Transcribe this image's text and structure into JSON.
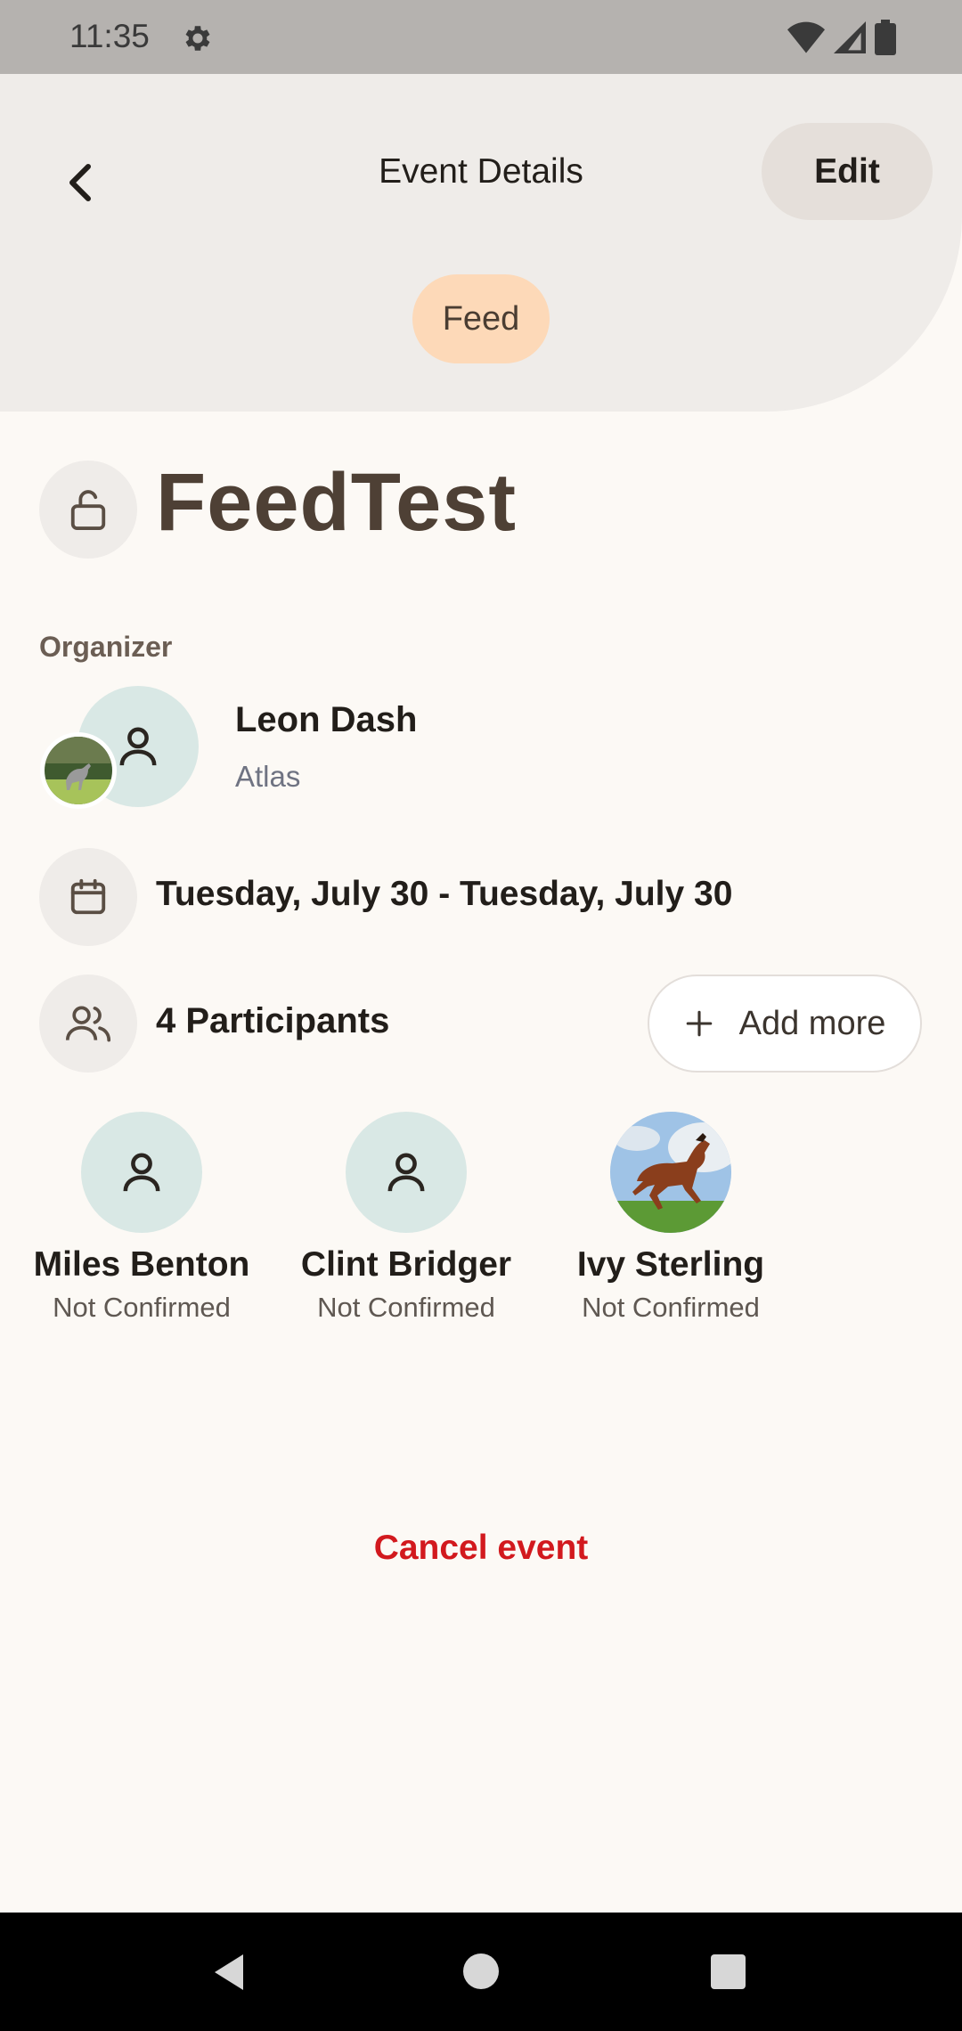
{
  "status_bar": {
    "time": "11:35",
    "icons": [
      "gear-icon",
      "wifi-icon",
      "signal-icon",
      "battery-icon"
    ]
  },
  "header": {
    "title": "Event Details",
    "edit_label": "Edit",
    "back_icon": "chevron-left-icon",
    "category_chip": "Feed"
  },
  "event": {
    "title": "FeedTest",
    "lock_icon": "unlock-icon"
  },
  "organizer": {
    "section_label": "Organizer",
    "name": "Leon Dash",
    "horse": "Atlas"
  },
  "date": {
    "icon": "calendar-icon",
    "text": "Tuesday, July 30 - Tuesday, July 30"
  },
  "participants": {
    "icon": "users-icon",
    "count_text": "4 Participants",
    "add_more_label": "Add more",
    "list": [
      {
        "name": "Miles Benton",
        "status": "Not Confirmed",
        "avatar": "person-icon"
      },
      {
        "name": "Clint Bridger",
        "status": "Not Confirmed",
        "avatar": "person-icon"
      },
      {
        "name": "Ivy Sterling",
        "status": "Not Confirmed",
        "avatar": "horse-photo"
      }
    ]
  },
  "actions": {
    "cancel_label": "Cancel event"
  },
  "colors": {
    "background": "#FCF9F5",
    "header_bg": "#EFECE9",
    "chip_bg": "#FDD9B8",
    "avatar_bg": "#D9E8E5",
    "danger": "#D2191E",
    "title_color": "#4E4035"
  }
}
